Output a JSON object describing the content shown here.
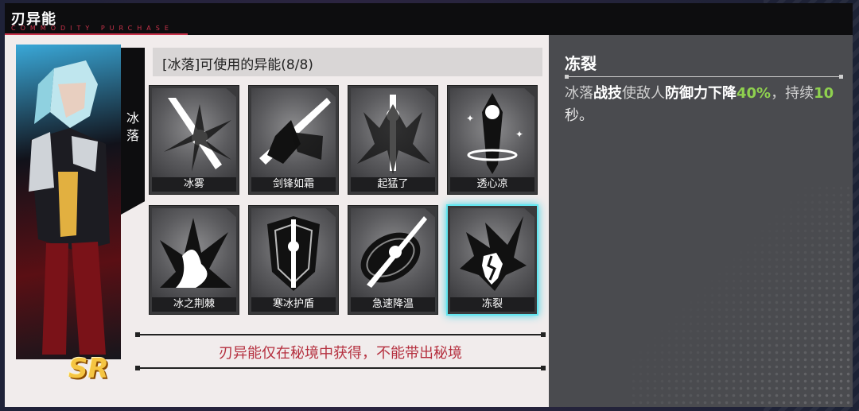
{
  "modal": {
    "title": "刃异能",
    "subtitle": "COMMODITY PURCHASE"
  },
  "character": {
    "name": "冰落",
    "rarity": "SR"
  },
  "skills_panel": {
    "header": "[冰落]可使用的异能(8/8)",
    "skills": [
      {
        "label": "冰雾",
        "icon": "ice-mist-sword-icon"
      },
      {
        "label": "剑锋如霜",
        "icon": "frost-blade-icon"
      },
      {
        "label": "起猛了",
        "icon": "rising-sword-icon"
      },
      {
        "label": "透心凉",
        "icon": "piercing-cold-icon"
      },
      {
        "label": "冰之荆棘",
        "icon": "ice-thorns-icon"
      },
      {
        "label": "寒冰护盾",
        "icon": "ice-shield-icon"
      },
      {
        "label": "急速降温",
        "icon": "rapid-cooling-icon"
      },
      {
        "label": "冻裂",
        "icon": "freeze-crack-icon"
      }
    ],
    "selected_index": 7,
    "notice": "刃异能仅在秘境中获得，不能带出秘境"
  },
  "detail": {
    "title": "冻裂",
    "desc_parts": [
      "冰落",
      "战技",
      "使敌人",
      "防御力下降",
      "40%",
      "，持续",
      "10",
      "秒。"
    ]
  },
  "colors": {
    "accent_red": "#c8324a",
    "selected_glow": "#63e6f0",
    "highlight_green": "#8fd14f",
    "notice_red": "#b5303f"
  }
}
